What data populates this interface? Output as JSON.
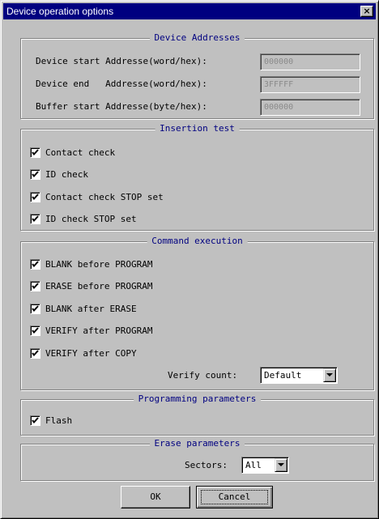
{
  "window": {
    "title": "Device operation options",
    "close_label": "×"
  },
  "device_addresses": {
    "legend": "Device Addresses",
    "rows": [
      {
        "label": "Device start Addresse(word/hex):",
        "value": "000000"
      },
      {
        "label": "Device end   Addresse(word/hex):",
        "value": "3FFFFF"
      },
      {
        "label": "Buffer start Addresse(byte/hex):",
        "value": "000000"
      }
    ]
  },
  "insertion_test": {
    "legend": "Insertion test",
    "items": [
      {
        "label": "Contact check",
        "checked": true
      },
      {
        "label": "ID check",
        "checked": true
      },
      {
        "label": "Contact check STOP set",
        "checked": true
      },
      {
        "label": "ID check STOP set",
        "checked": true
      }
    ]
  },
  "command_execution": {
    "legend": "Command execution",
    "items": [
      {
        "label": "BLANK before PROGRAM",
        "checked": true
      },
      {
        "label": "ERASE before PROGRAM",
        "checked": true
      },
      {
        "label": "BLANK after ERASE",
        "checked": true
      },
      {
        "label": "VERIFY after PROGRAM",
        "checked": true
      },
      {
        "label": "VERIFY after COPY",
        "checked": true
      }
    ],
    "verify_count_label": "Verify count:",
    "verify_count_value": "Default"
  },
  "programming_parameters": {
    "legend": "Programming parameters",
    "items": [
      {
        "label": "Flash",
        "checked": true
      }
    ]
  },
  "erase_parameters": {
    "legend": "Erase parameters",
    "sectors_label": "Sectors:",
    "sectors_value": "All"
  },
  "buttons": {
    "ok": "OK",
    "cancel": "Cancel"
  }
}
